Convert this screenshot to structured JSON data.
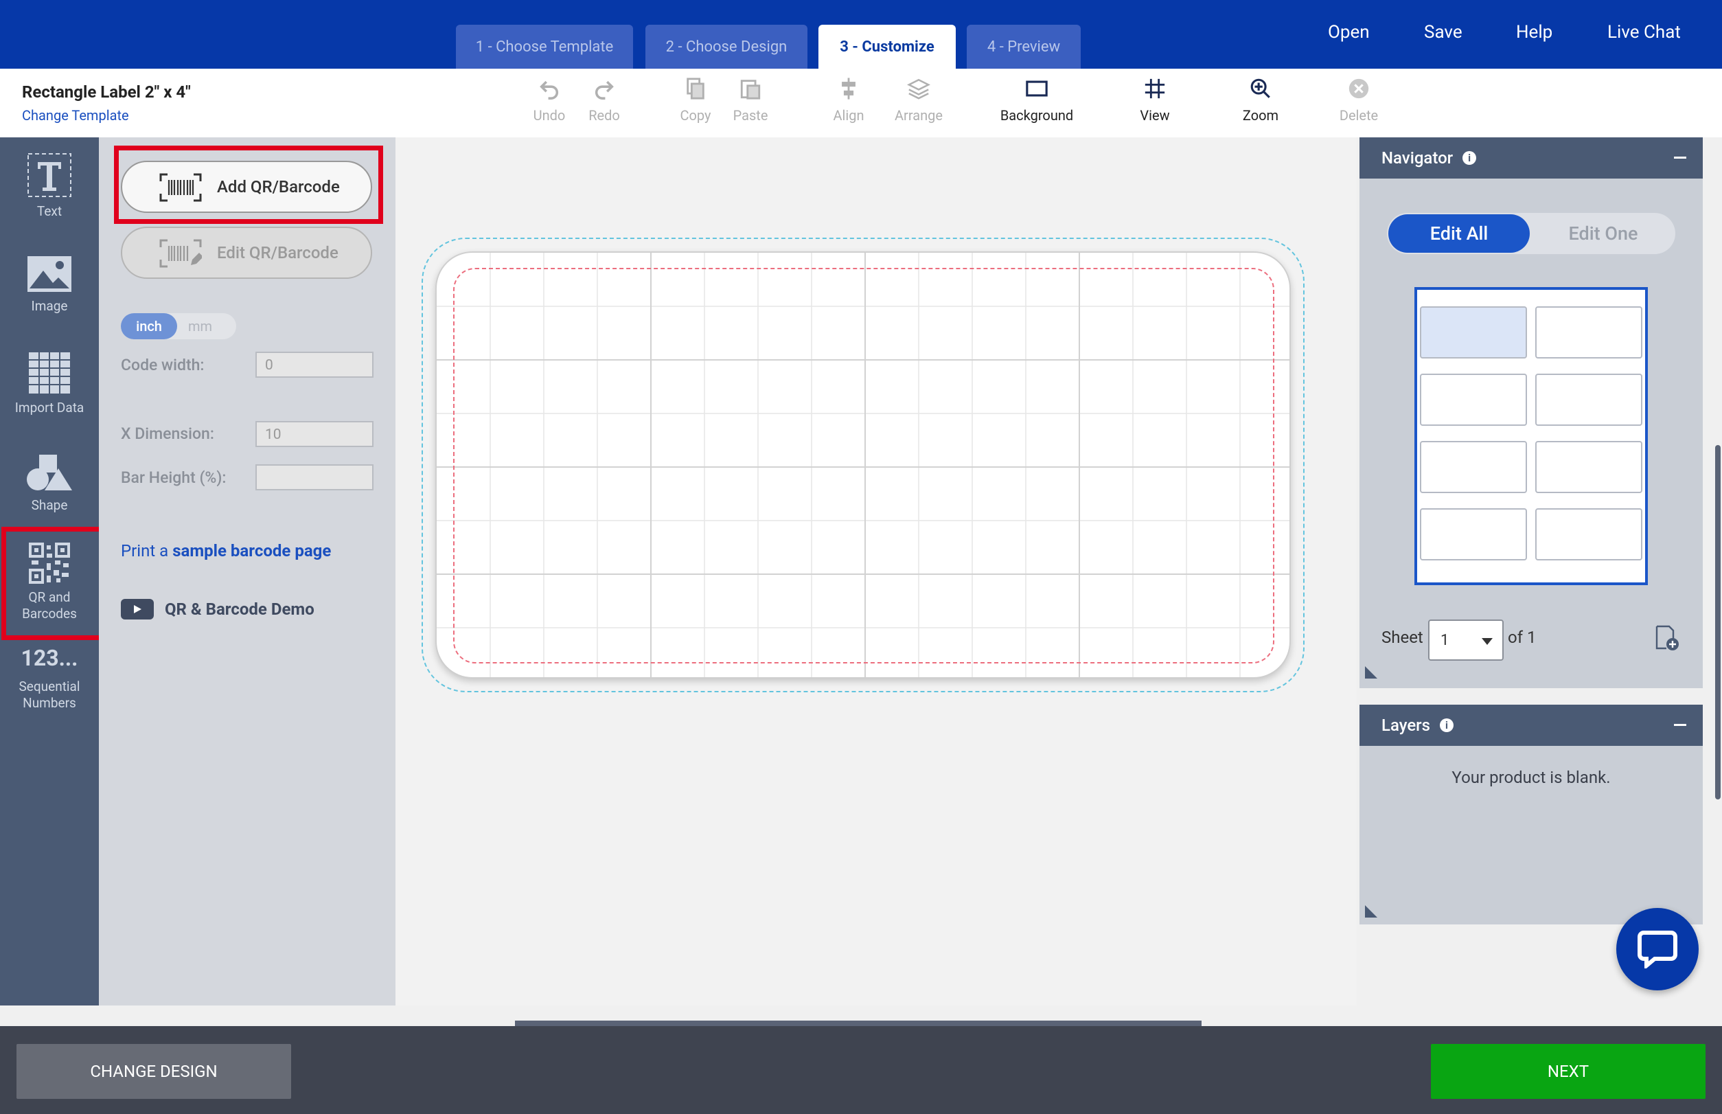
{
  "steps": [
    "1 - Choose Template",
    "2 - Choose Design",
    "3 - Customize",
    "4 - Preview"
  ],
  "top_links": {
    "open": "Open",
    "save": "Save",
    "help": "Help",
    "live_chat": "Live Chat"
  },
  "product": {
    "title": "Rectangle Label 2\" x 4\"",
    "change_template": "Change Template"
  },
  "toolbar": {
    "undo": "Undo",
    "redo": "Redo",
    "copy": "Copy",
    "paste": "Paste",
    "align": "Align",
    "arrange": "Arrange",
    "background": "Background",
    "view": "View",
    "zoom": "Zoom",
    "delete": "Delete"
  },
  "rail": {
    "text": "Text",
    "image": "Image",
    "import_data": "Import Data",
    "shape": "Shape",
    "qr_line1": "QR and",
    "qr_line2": "Barcodes",
    "seq_icon": "123...",
    "seq_line1": "Sequential",
    "seq_line2": "Numbers"
  },
  "barcode_panel": {
    "add_button": "Add QR/Barcode",
    "edit_button": "Edit QR/Barcode",
    "unit_inch": "inch",
    "unit_mm": "mm",
    "code_width_label": "Code width:",
    "code_width_value": "0",
    "x_dimension_label": "X Dimension:",
    "x_dimension_value": "10",
    "bar_height_label": "Bar Height (%):",
    "bar_height_value": "",
    "print_prefix": "Print a",
    "print_link": "sample barcode page",
    "demo_label": "QR & Barcode Demo"
  },
  "navigator": {
    "title": "Navigator",
    "edit_all": "Edit All",
    "edit_one": "Edit One",
    "sheet_label": "Sheet",
    "sheet_value": "1",
    "of_label": "of 1"
  },
  "layers": {
    "title": "Layers",
    "empty_message": "Your product is blank."
  },
  "bottom": {
    "change_design": "CHANGE DESIGN",
    "next": "NEXT"
  },
  "colors": {
    "brand_blue": "#0638a8",
    "next_green": "#09a512",
    "highlight_red": "#e0001c"
  }
}
